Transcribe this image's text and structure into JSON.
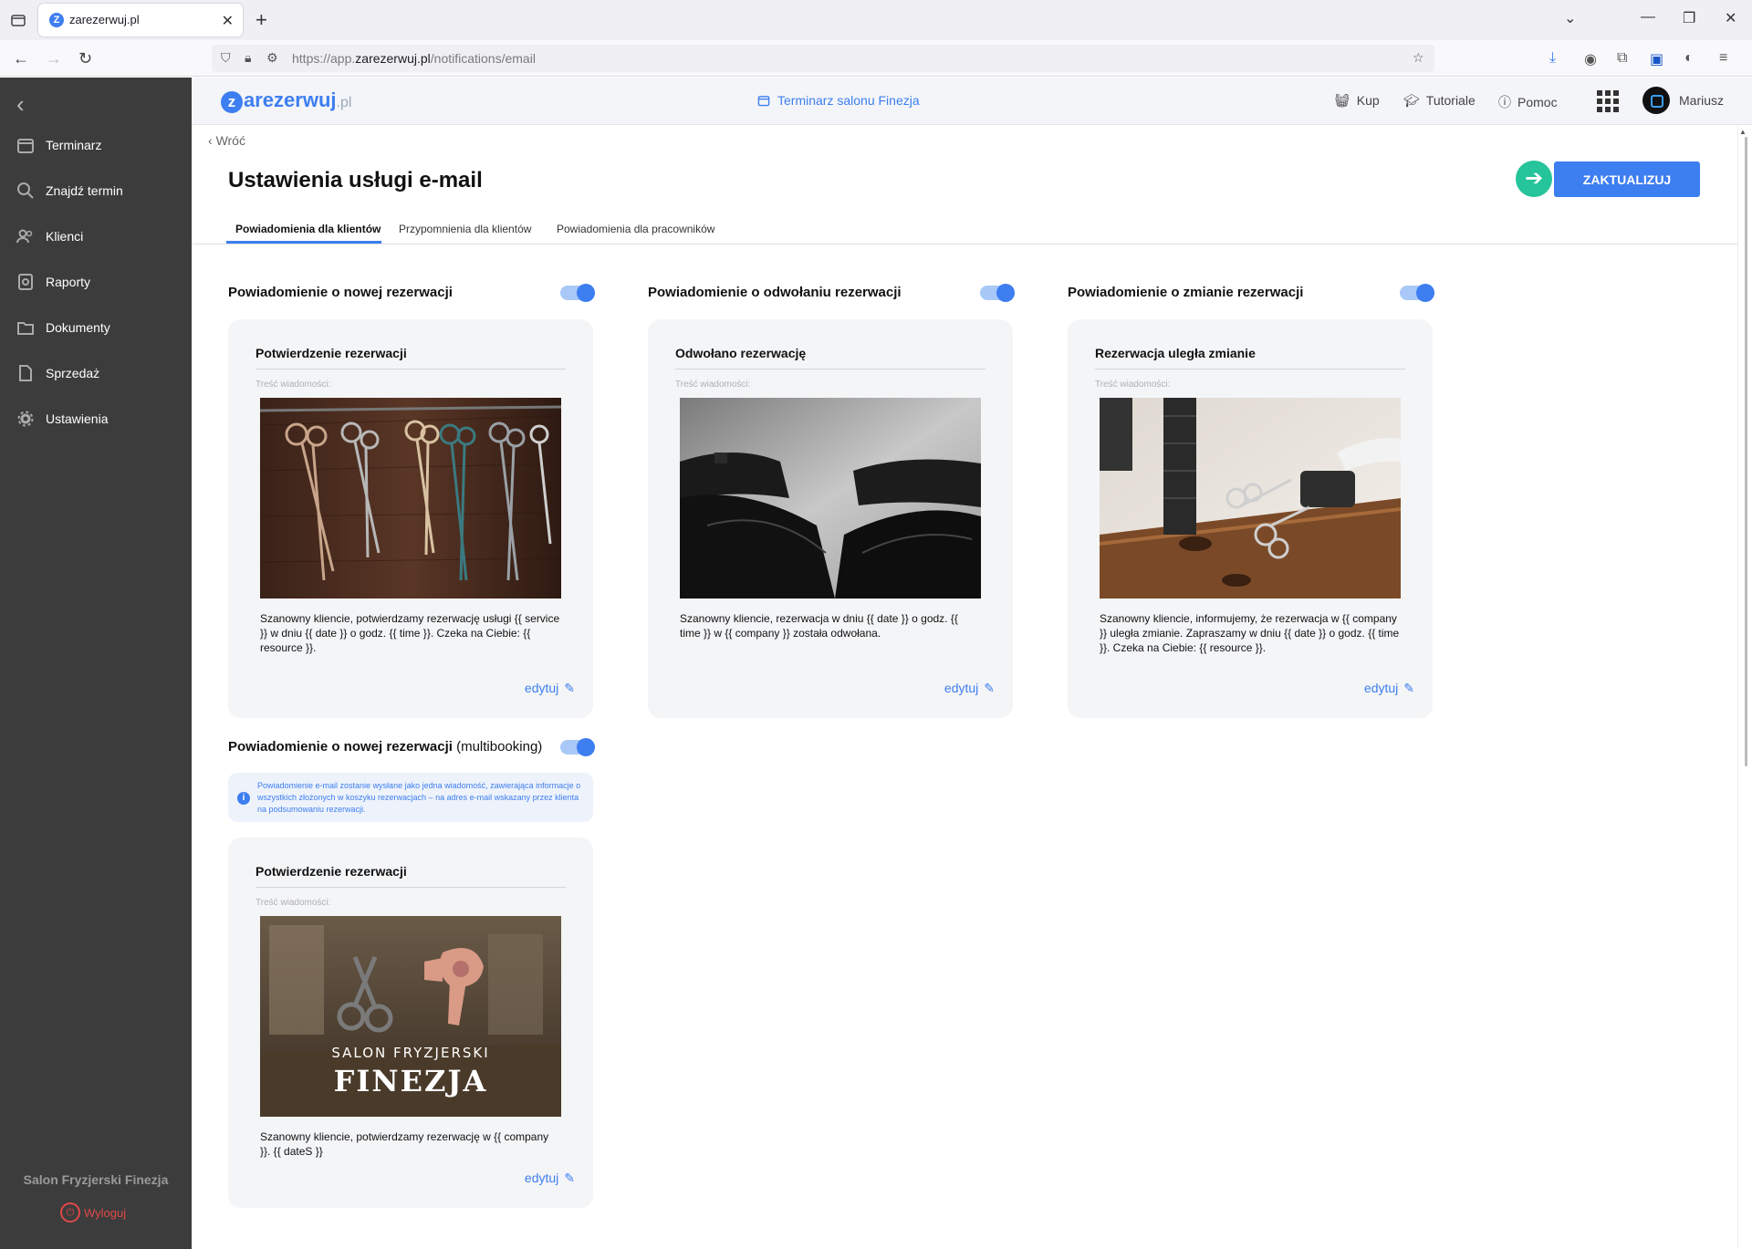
{
  "browser": {
    "tab_title": "zarezerwuj.pl",
    "favicon_letter": "Z",
    "url_prefix": "https://app.",
    "url_domain": "zarezerwuj.pl",
    "url_path": "/notifications/email"
  },
  "sidebar": {
    "items": [
      {
        "label": "Terminarz",
        "icon": "calendar-icon"
      },
      {
        "label": "Znajdź termin",
        "icon": "search-icon"
      },
      {
        "label": "Klienci",
        "icon": "users-icon"
      },
      {
        "label": "Raporty",
        "icon": "report-icon"
      },
      {
        "label": "Dokumenty",
        "icon": "folder-icon"
      },
      {
        "label": "Sprzedaż",
        "icon": "document-icon"
      },
      {
        "label": "Ustawienia",
        "icon": "gear-icon"
      }
    ],
    "salon_name": "Salon Fryzjerski Finezja",
    "logout_label": "Wyloguj"
  },
  "header": {
    "logo_text": "arezerwuj",
    "logo_z": "z",
    "logo_suffix": ".pl",
    "calendar_link": "Terminarz salonu Finezja",
    "buy_label": "Kup",
    "tutorials_label": "Tutoriale",
    "help_label": "Pomoc",
    "user_name": "Mariusz"
  },
  "page": {
    "back_label": "Wróć",
    "title": "Ustawienia usługi e-mail",
    "update_button": "ZAKTUALIZUJ",
    "tabs": [
      {
        "label": "Powiadomienia dla klientów",
        "active": true
      },
      {
        "label": "Przypomnienia dla klientów",
        "active": false
      },
      {
        "label": "Powiadomienia dla pracowników",
        "active": false
      }
    ]
  },
  "sections": [
    {
      "heading": "Powiadomienie o nowej rezerwacji",
      "enabled": true,
      "card": {
        "title": "Potwierdzenie rezerwacji",
        "meta": "Treść wiadomości:",
        "image": "scissors-hanging-image",
        "body": "Szanowny kliencie,  potwierdzamy rezerwację usługi {{ service }}  w dniu {{ date }} o godz. {{ time }}. Czeka na Ciebie: {{ resource }}.",
        "edit": "edytuj"
      }
    },
    {
      "heading": "Powiadomienie o odwołaniu rezerwacji",
      "enabled": true,
      "card": {
        "title": "Odwołano rezerwację",
        "meta": "Treść wiadomości:",
        "image": "salon-chairs-image",
        "body": "Szanowny kliencie,  rezerwacja w dniu {{ date }} o godz. {{ time }} w {{ company }} została odwołana.",
        "edit": "edytuj"
      }
    },
    {
      "heading": "Powiadomienie o zmianie rezerwacji",
      "enabled": true,
      "card": {
        "title": "Rezerwacja uległa zmianie",
        "meta": "Treść wiadomości:",
        "image": "hair-tools-image",
        "body": "Szanowny kliencie,  informujemy, że rezerwacja w {{ company }} uległa zmianie. Zapraszamy w dniu {{ date }} o godz. {{ time }}. Czeka na Ciebie: {{ resource }}.",
        "edit": "edytuj"
      }
    },
    {
      "heading": "Powiadomienie o nowej rezerwacji",
      "heading_suffix": "(multibooking)",
      "enabled": true,
      "info": "Powiadomienie e-mail zostanie wysłane jako jedna wiadomość, zawierająca informacje o wszystkich złożonych w koszyku rezerwacjach – na adres e-mail wskazany przez klienta na podsumowaniu rezerwacji.",
      "card": {
        "title": "Potwierdzenie rezerwacji",
        "meta": "Treść wiadomości:",
        "image": "salon-logo-image",
        "image_text_top": "SALON FRYZJERSKI",
        "image_text_main": "FINEZJA",
        "body": "Szanowny kliencie, potwierdzamy rezerwację w {{ company }}. {{ dateS }}",
        "edit": "edytuj"
      }
    }
  ],
  "colors": {
    "accent": "#3d7ef0",
    "sidebar_bg": "#3c3c3c",
    "arrow_circle": "#25c49a",
    "logout": "#e04848"
  }
}
